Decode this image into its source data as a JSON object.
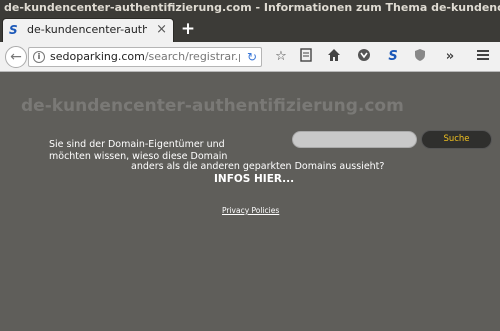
{
  "window": {
    "title": "de-kundencenter-authentifizierung.com - Informationen zum Thema de-kundencenter-aut..."
  },
  "tab": {
    "title": "de-kundencenter-authentifi",
    "close": "×",
    "favicon": "S"
  },
  "new_tab": "+",
  "urlbar": {
    "host": "sedoparking.com",
    "path": "/search/registrar.php?",
    "info": "i",
    "reload": "↻"
  },
  "toolbar_icons": [
    "star-icon",
    "reading-list-icon",
    "home-icon",
    "pocket-icon",
    "sedo-icon",
    "shield-icon",
    "overflow-icon",
    "menu-icon"
  ],
  "page": {
    "domain": "de-kundencenter-authentifizierung.com",
    "message_line1": "Sie sind der Domain-Eigentümer und",
    "message_line2": "möchten wissen, wieso diese Domain",
    "message_line3": "anders als die anderen geparkten Domains aussieht?",
    "infos_link": "INFOS HIER...",
    "search_value": "",
    "search_button": "Suche",
    "privacy_link": "Privacy Policies"
  },
  "colors": {
    "content_bg": "#5f5e5a",
    "domain_text": "#7a7976",
    "search_button_text": "#f0c020"
  }
}
